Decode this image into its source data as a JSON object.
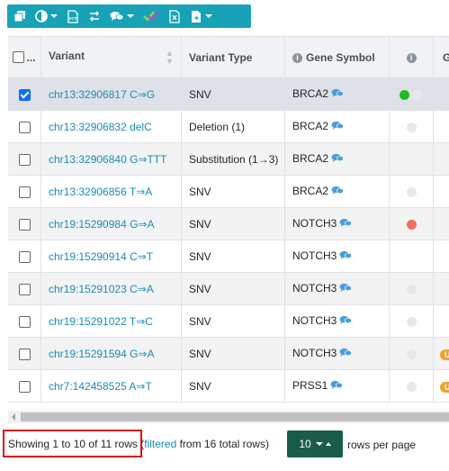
{
  "toolbar": {
    "buttons": [
      {
        "icon": "copy-icon",
        "dropdown": false
      },
      {
        "icon": "contrast-icon",
        "dropdown": true
      },
      {
        "icon": "vcf-export-icon",
        "dropdown": false
      },
      {
        "icon": "exchange-icon",
        "dropdown": false
      },
      {
        "icon": "comments-icon",
        "dropdown": true
      },
      {
        "icon": "double-check-icon",
        "dropdown": false
      },
      {
        "icon": "excel-export-icon",
        "dropdown": false
      },
      {
        "icon": "file-export-icon",
        "dropdown": true
      }
    ]
  },
  "table": {
    "header": {
      "select_all_dots": "...",
      "variant": "Variant",
      "variant_type": "Variant Type",
      "gene_symbol": "Gene Symbol",
      "info": "",
      "g": "G"
    },
    "rows": [
      {
        "selected": true,
        "variant": "chr13:32906817 C⇒G",
        "type": "SNV",
        "gene": "BRCA2",
        "dots": [
          "green",
          "grey"
        ],
        "badge": ""
      },
      {
        "selected": false,
        "variant": "chr13:32906832 delC",
        "type": "Deletion (1)",
        "gene": "BRCA2",
        "dots": [
          "grey"
        ],
        "badge": ""
      },
      {
        "selected": false,
        "variant": "chr13:32906840 G⇒TTT",
        "type": "Substitution (1→3)",
        "gene": "BRCA2",
        "dots": [],
        "badge": ""
      },
      {
        "selected": false,
        "variant": "chr13:32906856 T⇒A",
        "type": "SNV",
        "gene": "BRCA2",
        "dots": [
          "grey"
        ],
        "badge": ""
      },
      {
        "selected": false,
        "variant": "chr19:15290984 G⇒A",
        "type": "SNV",
        "gene": "NOTCH3",
        "dots": [
          "red"
        ],
        "badge": ""
      },
      {
        "selected": false,
        "variant": "chr19:15290914 C⇒T",
        "type": "SNV",
        "gene": "NOTCH3",
        "dots": [],
        "badge": ""
      },
      {
        "selected": false,
        "variant": "chr19:15291023 C⇒A",
        "type": "SNV",
        "gene": "NOTCH3",
        "dots": [
          "grey"
        ],
        "badge": ""
      },
      {
        "selected": false,
        "variant": "chr19:15291022 T⇒C",
        "type": "SNV",
        "gene": "NOTCH3",
        "dots": [
          "grey"
        ],
        "badge": ""
      },
      {
        "selected": false,
        "variant": "chr19:15291594 G⇒A",
        "type": "SNV",
        "gene": "NOTCH3",
        "dots": [
          "grey"
        ],
        "badge": "Un"
      },
      {
        "selected": false,
        "variant": "chr7:142458525 A⇒T",
        "type": "SNV",
        "gene": "PRSS1",
        "dots": [
          "grey"
        ],
        "badge": "Un"
      }
    ]
  },
  "pagination": {
    "showing": "Showing 1 to 10 of 11 rows",
    "filtered_open": " (",
    "filtered_link": "filtered",
    "filtered_rest": " from 16 total rows)",
    "page_size": "10",
    "rows_per_page": "rows per page"
  },
  "colors": {
    "toolbar": "#17a2b8",
    "link": "#1a8bb3",
    "page_size_button": "#1a5c4a",
    "highlight_box": "#dd1111"
  }
}
